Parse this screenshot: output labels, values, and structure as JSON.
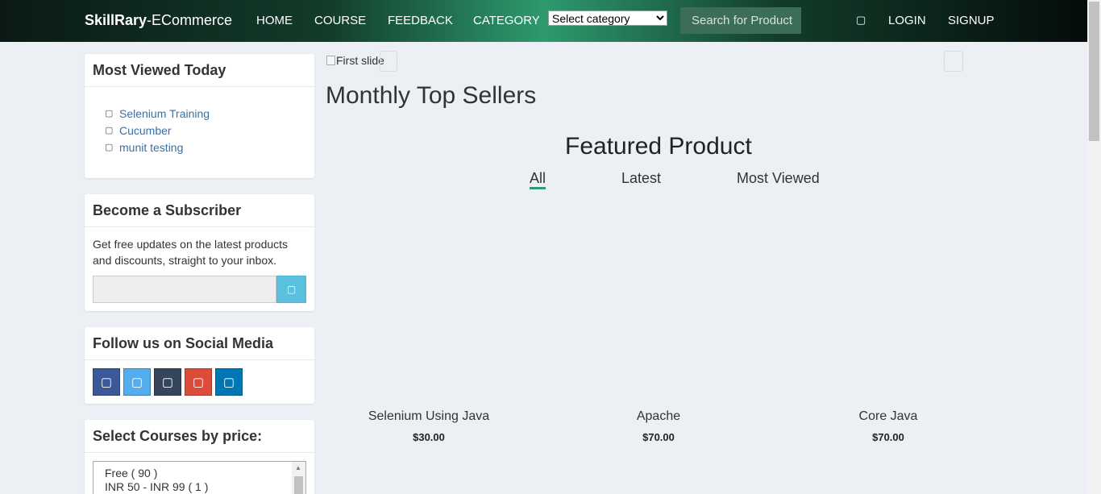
{
  "brand": {
    "bold": "SkillRary",
    "rest": "-ECommerce"
  },
  "nav": {
    "home": "HOME",
    "course": "COURSE",
    "feedback": "FEEDBACK",
    "category": "CATEGORY",
    "login": "LOGIN",
    "signup": "SIGNUP"
  },
  "category_select": {
    "selected": "Select category"
  },
  "search": {
    "placeholder": "Search for Product"
  },
  "sidebar": {
    "most_viewed": {
      "title": "Most Viewed Today",
      "items": [
        "Selenium Training",
        "Cucumber",
        "munit testing"
      ]
    },
    "subscriber": {
      "title": "Become a Subscriber",
      "text": "Get free updates on the latest products and discounts, straight to your inbox."
    },
    "social": {
      "title": "Follow us on Social Media",
      "icons": [
        "facebook-icon",
        "twitter-icon",
        "tumblr-icon",
        "google-plus-icon",
        "linkedin-icon"
      ],
      "colors": [
        "#3b5998",
        "#55acee",
        "#35465c",
        "#dd4b39",
        "#0077b5"
      ]
    },
    "price": {
      "title": "Select Courses by price:",
      "options": [
        "Free ( 90 )",
        "INR 50 - INR 99 ( 1 )"
      ]
    }
  },
  "main": {
    "carousel_alt": "First slide",
    "top_sellers": "Monthly Top Sellers",
    "featured_title": "Featured Product",
    "tabs": [
      "All",
      "Latest",
      "Most Viewed"
    ],
    "products": [
      {
        "name": "Selenium Using Java",
        "price": "$30.00"
      },
      {
        "name": "Apache",
        "price": "$70.00"
      },
      {
        "name": "Core Java",
        "price": "$70.00"
      }
    ]
  },
  "colors": {
    "accent": "#2e9a6e",
    "link": "#3a6fa6",
    "subscribe_button": "#5bc0de"
  }
}
